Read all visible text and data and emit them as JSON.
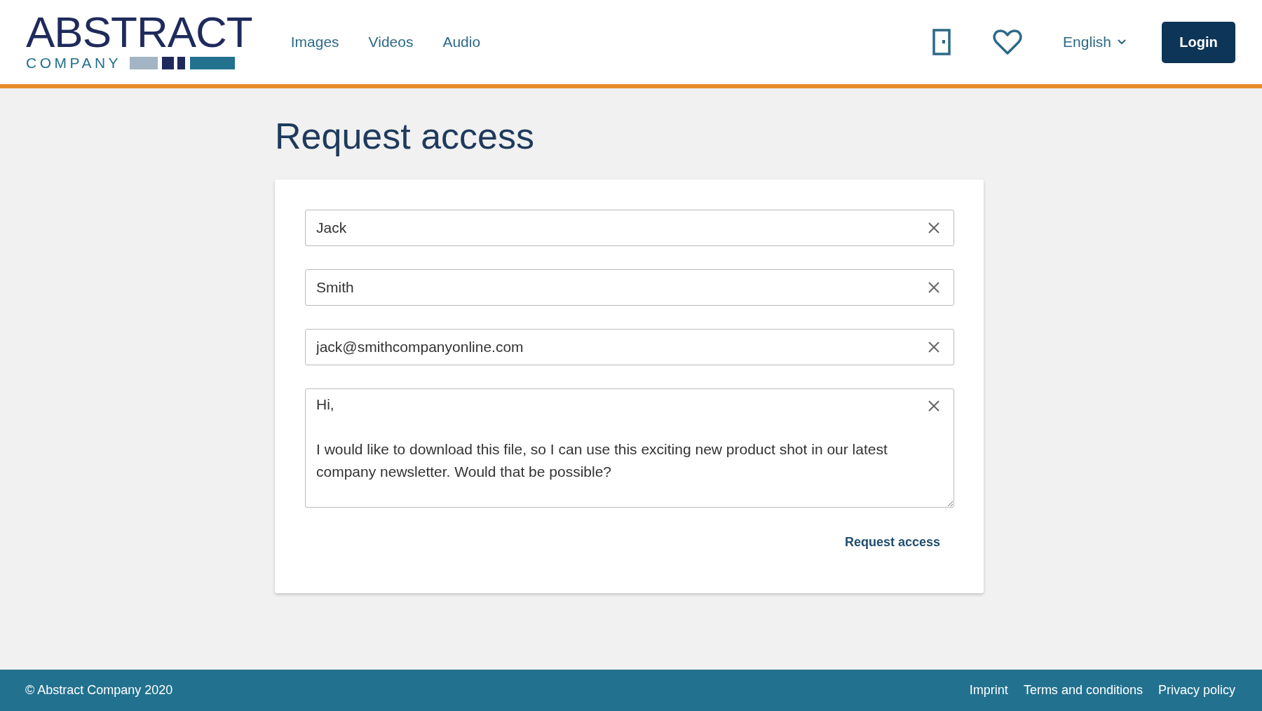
{
  "header": {
    "logo": {
      "name": "ABSTRACT",
      "subtitle": "COMPANY"
    },
    "nav": [
      {
        "label": "Images"
      },
      {
        "label": "Videos"
      },
      {
        "label": "Audio"
      }
    ],
    "language": "English",
    "login": "Login"
  },
  "page_title": "Request access",
  "form": {
    "fields": [
      {
        "kind": "input",
        "value": "Jack"
      },
      {
        "kind": "input",
        "value": "Smith"
      },
      {
        "kind": "input",
        "value": "jack@smithcompanyonline.com"
      },
      {
        "kind": "textarea",
        "value": "Hi,\n\nI would like to download this file, so I can use this exciting new product shot in our latest company newsletter. Would that be possible?"
      }
    ],
    "submit": "Request access"
  },
  "footer": {
    "copyright": "© Abstract Company 2020",
    "links": [
      "Imprint",
      "Terms and conditions",
      "Privacy policy"
    ]
  }
}
